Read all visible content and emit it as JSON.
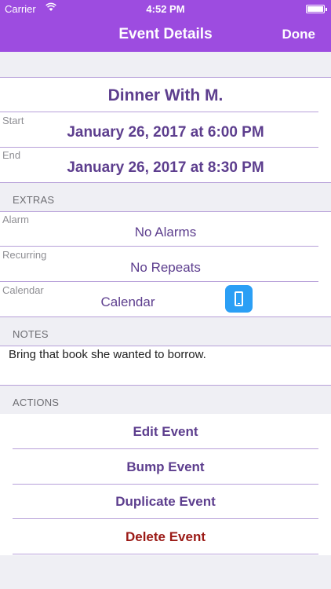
{
  "status_bar": {
    "carrier": "Carrier",
    "time": "4:52 PM"
  },
  "nav": {
    "title": "Event Details",
    "done_label": "Done"
  },
  "event": {
    "title": "Dinner With M.",
    "start_label": "Start",
    "start_value": "January 26, 2017 at 6:00 PM",
    "end_label": "End",
    "end_value": "January 26, 2017 at 8:30 PM"
  },
  "extras": {
    "header": "EXTRAS",
    "alarm_label": "Alarm",
    "alarm_value": "No Alarms",
    "recurring_label": "Recurring",
    "recurring_value": "No Repeats",
    "calendar_label": "Calendar",
    "calendar_value": "Calendar",
    "calendar_icon": "phone-icon"
  },
  "notes": {
    "header": "NOTES",
    "text": "Bring that book she wanted to borrow."
  },
  "actions": {
    "header": "ACTIONS",
    "edit": "Edit Event",
    "bump": "Bump Event",
    "duplicate": "Duplicate Event",
    "delete": "Delete Event"
  },
  "colors": {
    "accent": "#9d4ce0",
    "text_primary": "#5d3e8e",
    "destructive": "#9b1a16",
    "icon_blue": "#2b9ff5"
  }
}
